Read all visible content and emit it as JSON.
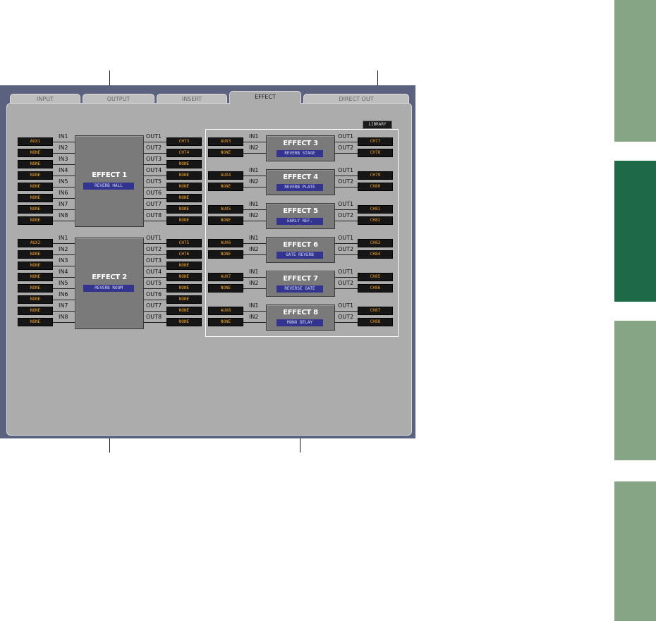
{
  "colors": {
    "side_tab_light": "#86a585",
    "side_tab_dark": "#1e6a47",
    "slot_text": "#f0a428",
    "name_bar": "#33348f",
    "frame": "#5a6280",
    "panel": "#acacac"
  },
  "tabs": [
    {
      "label": "INPUT",
      "active": false
    },
    {
      "label": "OUTPUT",
      "active": false
    },
    {
      "label": "INSERT",
      "active": false
    },
    {
      "label": "EFFECT",
      "active": true
    },
    {
      "label": "DIRECT OUT",
      "active": false
    }
  ],
  "library_label": "LIBRARY",
  "effects_large": [
    {
      "title": "EFFECT 1",
      "name": "REVERB HALL",
      "inputs": [
        "AUX1",
        "NONE",
        "NONE",
        "NONE",
        "NONE",
        "NONE",
        "NONE",
        "NONE"
      ],
      "outputs": [
        "CH73",
        "CH74",
        "NONE",
        "NONE",
        "NONE",
        "NONE",
        "NONE",
        "NONE"
      ]
    },
    {
      "title": "EFFECT 2",
      "name": "REVERB ROOM",
      "inputs": [
        "AUX2",
        "NONE",
        "NONE",
        "NONE",
        "NONE",
        "NONE",
        "NONE",
        "NONE"
      ],
      "outputs": [
        "CH75",
        "CH76",
        "NONE",
        "NONE",
        "NONE",
        "NONE",
        "NONE",
        "NONE"
      ]
    }
  ],
  "effects_small": [
    {
      "title": "EFFECT 3",
      "name": "REVERB STAGE",
      "inputs": [
        "AUX3",
        "NONE"
      ],
      "outputs": [
        "CH77",
        "CH78"
      ]
    },
    {
      "title": "EFFECT 4",
      "name": "REVERB PLATE",
      "inputs": [
        "AUX4",
        "NONE"
      ],
      "outputs": [
        "CH79",
        "CH80"
      ]
    },
    {
      "title": "EFFECT 5",
      "name": "EARLY REF.",
      "inputs": [
        "AUX5",
        "NONE"
      ],
      "outputs": [
        "CH81",
        "CH82"
      ]
    },
    {
      "title": "EFFECT 6",
      "name": "GATE REVERB",
      "inputs": [
        "AUX6",
        "NONE"
      ],
      "outputs": [
        "CH83",
        "CH84"
      ]
    },
    {
      "title": "EFFECT 7",
      "name": "REVERSE GATE",
      "inputs": [
        "AUX7",
        "NONE"
      ],
      "outputs": [
        "CH85",
        "CH86"
      ]
    },
    {
      "title": "EFFECT 8",
      "name": "MONO DELAY",
      "inputs": [
        "AUX8",
        "NONE"
      ],
      "outputs": [
        "CH87",
        "CH88"
      ]
    }
  ],
  "in_labels": [
    "IN1",
    "IN2",
    "IN3",
    "IN4",
    "IN5",
    "IN6",
    "IN7",
    "IN8"
  ],
  "out_labels": [
    "OUT1",
    "OUT2",
    "OUT3",
    "OUT4",
    "OUT5",
    "OUT6",
    "OUT7",
    "OUT8"
  ]
}
